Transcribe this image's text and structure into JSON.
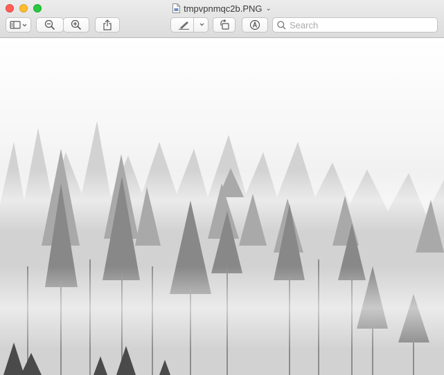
{
  "window": {
    "title": "tmpvpnmqc2b.PNG"
  },
  "toolbar": {
    "buttons": [
      {
        "name": "sidebar-toggle",
        "icon": "sidebar-icon"
      },
      {
        "name": "zoom-out",
        "icon": "zoom-out-icon"
      },
      {
        "name": "zoom-in",
        "icon": "zoom-in-icon"
      },
      {
        "name": "share",
        "icon": "share-icon"
      },
      {
        "name": "markup-pen",
        "icon": "pen-icon"
      },
      {
        "name": "rotate",
        "icon": "rotate-left-icon"
      },
      {
        "name": "annotate",
        "icon": "markup-icon"
      }
    ],
    "search": {
      "placeholder": "Search",
      "value": ""
    }
  },
  "image": {
    "subject": "foggy-forest",
    "colors": {
      "fog": "#f4f4f4",
      "far_trees": "#c9c9c9",
      "mid_trees": "#9a9a9a",
      "near_trees": "#6e6e6e"
    }
  },
  "colors": {
    "close": "#ff5f57",
    "minimize": "#febc2e",
    "zoom": "#28c840",
    "toolbar_bg": "#e4e4e4"
  }
}
